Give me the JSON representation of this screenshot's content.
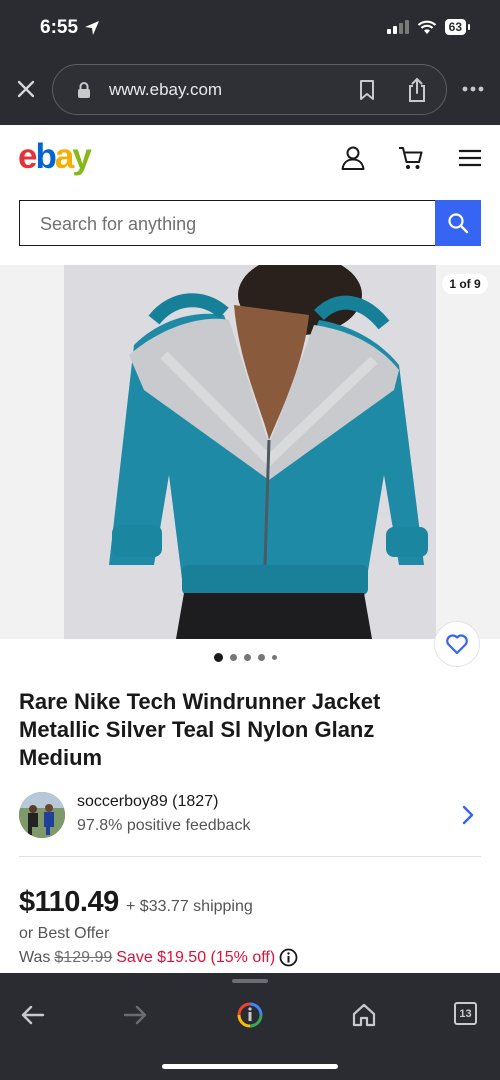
{
  "status": {
    "time": "6:55",
    "battery": "63"
  },
  "browser": {
    "url": "www.ebay.com",
    "tabs_count": "13"
  },
  "header": {
    "logo_letters": [
      "e",
      "b",
      "a",
      "y"
    ]
  },
  "search": {
    "placeholder": "Search for anything"
  },
  "gallery": {
    "counter": "1 of 9",
    "dots": 5,
    "active_dot": 1
  },
  "listing": {
    "title": "Rare Nike Tech Windrunner Jacket Metallic Silver Teal Sl Nylon Glanz Medium",
    "seller_name": "soccerboy89 (1827)",
    "seller_feedback": "97.8% positive feedback",
    "price": "$110.49",
    "shipping": "+ $33.77 shipping",
    "best_offer": "or Best Offer",
    "was_label": "Was",
    "was_price": "$129.99",
    "save_text": "Save $19.50 (15% off)"
  },
  "colors": {
    "accent": "#3665f3",
    "save_red": "#e0103a",
    "chrome": "#2b2c31"
  },
  "icons": [
    "location-arrow-icon",
    "signal-icon",
    "wifi-icon",
    "close-icon",
    "lock-icon",
    "bookmark-icon",
    "share-icon",
    "more-icon",
    "user-icon",
    "cart-icon",
    "menu-icon",
    "search-icon",
    "heart-icon",
    "chevron-right-icon",
    "info-icon",
    "back-icon",
    "forward-icon",
    "google-icon",
    "home-icon"
  ]
}
